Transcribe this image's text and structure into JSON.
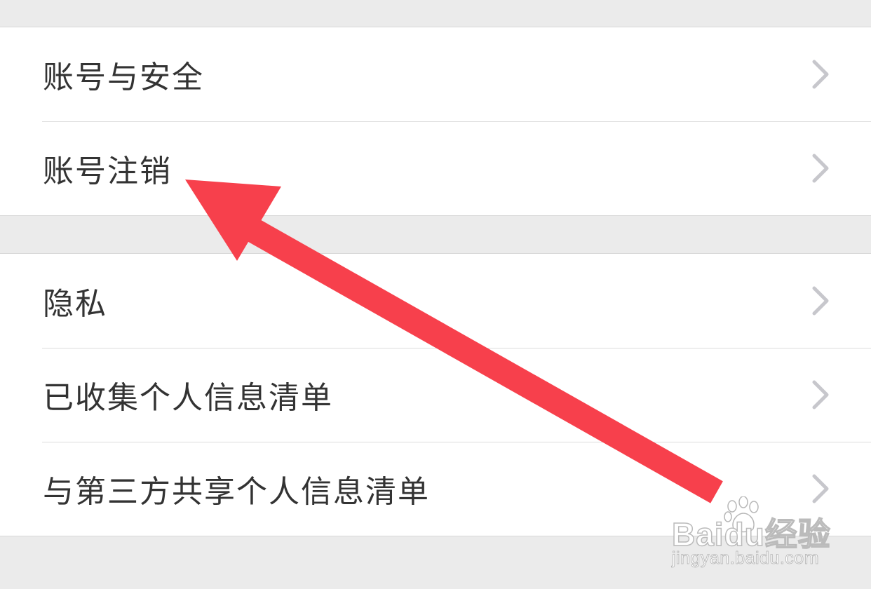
{
  "settings": {
    "group1": [
      {
        "label": "账号与安全"
      },
      {
        "label": "账号注销"
      }
    ],
    "group2": [
      {
        "label": "隐私"
      },
      {
        "label": "已收集个人信息清单"
      },
      {
        "label": "与第三方共享个人信息清单"
      }
    ]
  },
  "icons": {
    "row": "chevron-right-icon",
    "annotation": "red-arrow-icon",
    "watermark": "baidu-paw-icon"
  },
  "colors": {
    "background": "#ebebeb",
    "row_background": "#ffffff",
    "text": "#333333",
    "chevron": "#c7c7cc",
    "annotation_arrow": "#f7404c"
  },
  "watermark": {
    "brand": "Baidu经验",
    "url": "jingyan.baidu.com"
  }
}
